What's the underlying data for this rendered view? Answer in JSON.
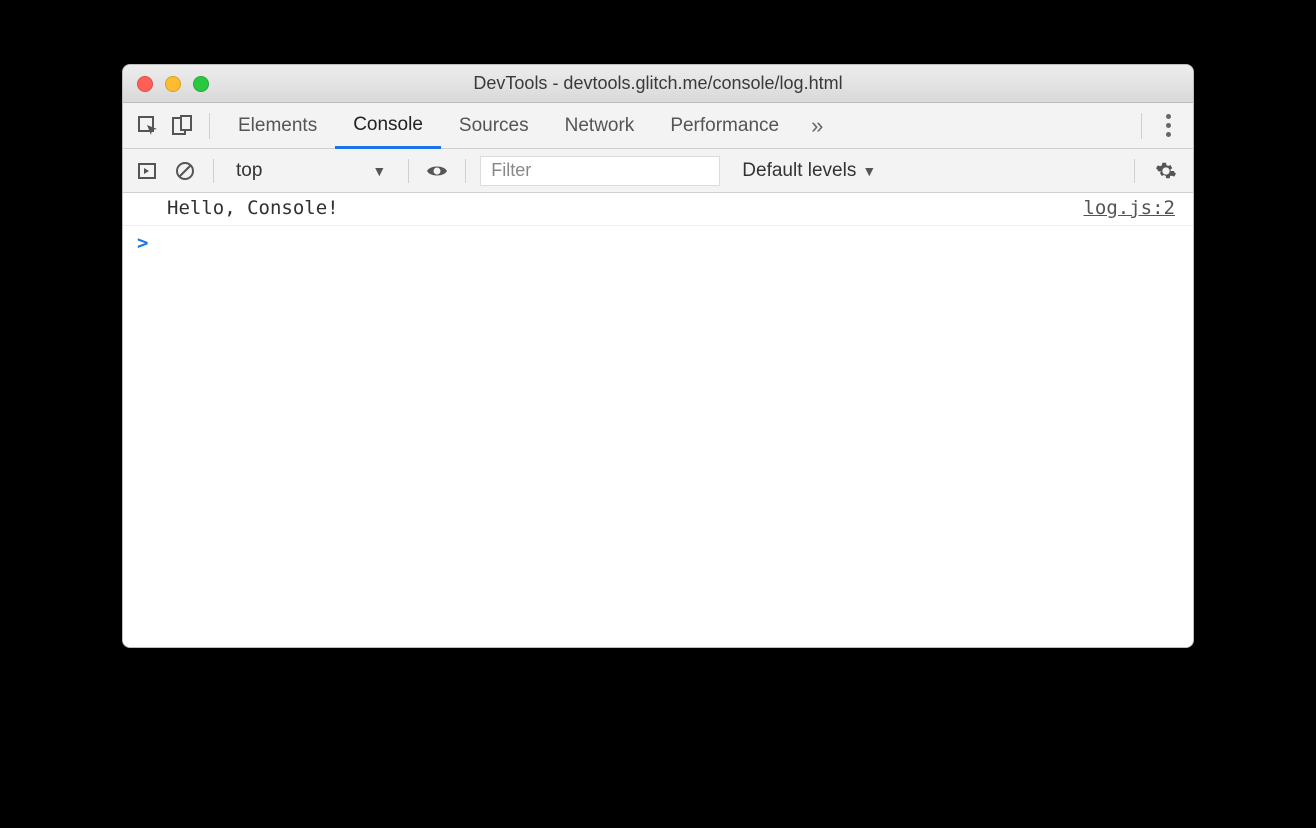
{
  "window": {
    "title": "DevTools - devtools.glitch.me/console/log.html"
  },
  "tabs": {
    "elements": "Elements",
    "console": "Console",
    "sources": "Sources",
    "network": "Network",
    "performance": "Performance"
  },
  "toolbar": {
    "context": "top",
    "filter_placeholder": "Filter",
    "levels": "Default levels"
  },
  "console": {
    "message": "Hello, Console!",
    "source": "log.js:2",
    "prompt": ">"
  }
}
